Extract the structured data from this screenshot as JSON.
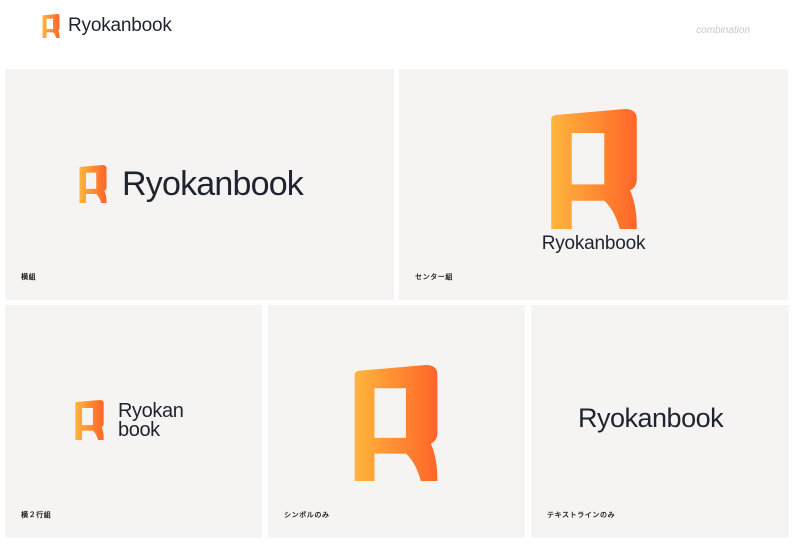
{
  "header": {
    "brand_name": "Ryokanbook",
    "section_tag": "combination"
  },
  "logo": {
    "brand_name": "Ryokanbook",
    "stack_line_1": "Ryokan",
    "stack_line_2": "book",
    "icon": "ryokanbook-r-mark-icon",
    "gradient": {
      "start": "#ffb53d",
      "end": "#ff6528"
    },
    "text_color": "#1f2430"
  },
  "panels": [
    {
      "label": "横組"
    },
    {
      "label": "センター組"
    },
    {
      "label": "横２行組"
    },
    {
      "label": "シンボルのみ"
    },
    {
      "label": "テキストラインのみ"
    }
  ]
}
